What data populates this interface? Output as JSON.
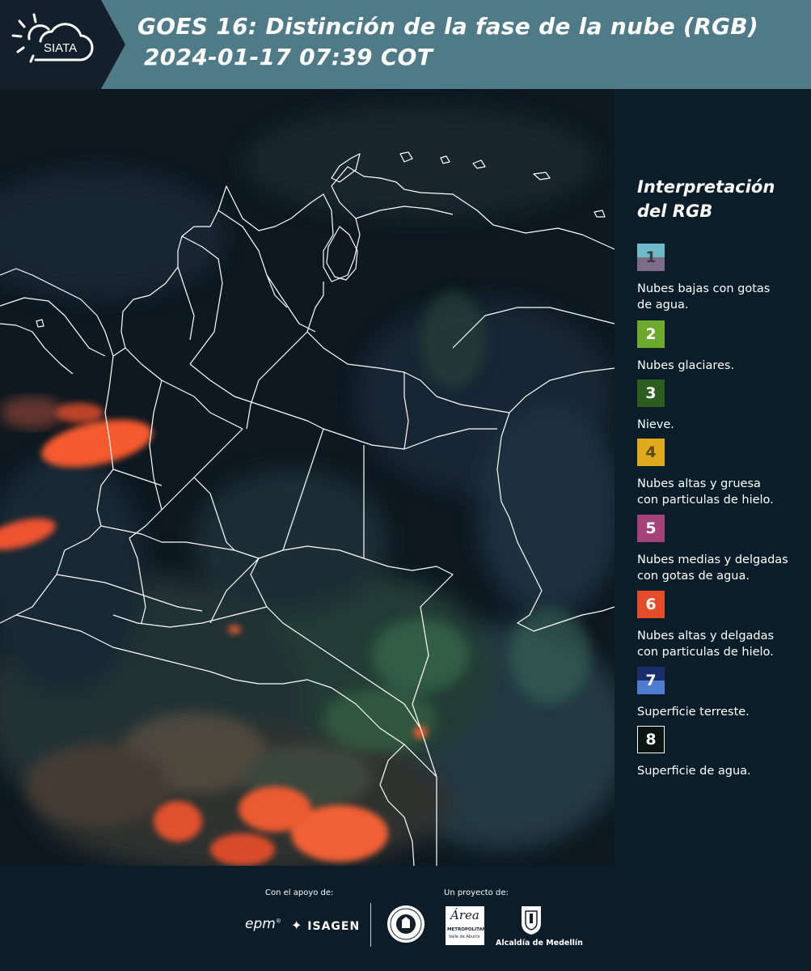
{
  "header": {
    "logo_text": "SIATA",
    "title_line1": "GOES 16: Distinción de la fase de la nube (RGB)",
    "title_line2": "2024-01-17 07:39 COT"
  },
  "legend": {
    "title_line1": "Interpretación",
    "title_line2": "del RGB",
    "items": [
      {
        "number": "1",
        "label": "Nubes bajas con gotas de agua.",
        "colors": [
          "#6fbac8",
          "#7d6c88"
        ],
        "text_color": "#3a3a48"
      },
      {
        "number": "2",
        "label": "Nubes glaciares.",
        "colors": [
          "#6caa2d"
        ],
        "text_color": "#ffffff"
      },
      {
        "number": "3",
        "label": "Nieve.",
        "colors": [
          "#2d5e1f"
        ],
        "text_color": "#ffffff"
      },
      {
        "number": "4",
        "label": "Nubes altas y gruesa con particulas de hielo.",
        "colors": [
          "#e0aa1f"
        ],
        "text_color": "#5a4a10"
      },
      {
        "number": "5",
        "label": "Nubes medias y delgadas con gotas de agua.",
        "colors": [
          "#a4437a"
        ],
        "text_color": "#ffffff"
      },
      {
        "number": "6",
        "label": "Nubes altas y delgadas con particulas de hielo.",
        "colors": [
          "#e44d2a"
        ],
        "text_color": "#ffffff"
      },
      {
        "number": "7",
        "label": "Superficie terreste.",
        "colors": [
          "#1a2e6c",
          "#4f7cd0"
        ],
        "text_color": "#ffffff"
      },
      {
        "number": "8",
        "label": "Superficie de agua.",
        "colors": [
          "#0a1410"
        ],
        "text_color": "#ffffff",
        "border": "#ffffff"
      }
    ]
  },
  "footer": {
    "support_label": "Con el apoyo de:",
    "project_label": "Un proyecto de:",
    "epm": "epm",
    "isagen": "ISAGEN",
    "area_metro": "Área",
    "area_metro_sub": "METROPOLITANA",
    "area_metro_sub2": "Valle de Aburrá",
    "alcaldia": "Alcaldía de Medellín"
  }
}
